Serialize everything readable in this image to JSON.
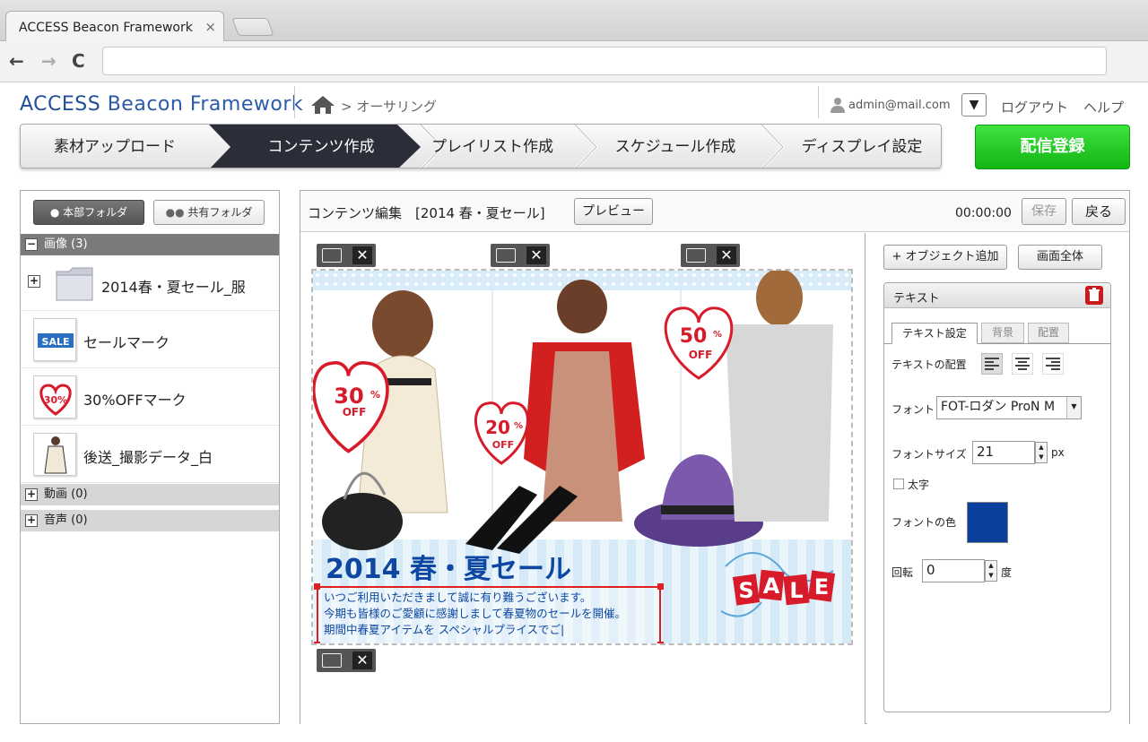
{
  "browser": {
    "tab_title": "ACCESS Beacon Framework",
    "tab_close": "×",
    "back": "←",
    "forward": "→",
    "reload": "C",
    "url": ""
  },
  "header": {
    "logo_access": "ACCESS",
    "logo_rest": " Beacon Framework",
    "breadcrumb": "> オーサリング",
    "user_email": "admin@mail.com",
    "dropdown_arrow": "▼",
    "logout": "ログアウト",
    "help": "ヘルプ"
  },
  "steps": [
    {
      "label": "素材アップロード",
      "active": false
    },
    {
      "label": "コンテンツ作成",
      "active": true
    },
    {
      "label": "プレイリスト作成",
      "active": false
    },
    {
      "label": "スケジュール作成",
      "active": false
    },
    {
      "label": "ディスプレイ設定",
      "active": false
    }
  ],
  "deliver_button": "配信登録",
  "left_panel": {
    "tab_hq": "本部フォルダ",
    "tab_shared": "共有フォルダ",
    "sections": [
      {
        "label": "画像 (3)",
        "expanded": true
      },
      {
        "label": "動画 (0)",
        "expanded": false
      },
      {
        "label": "音声 (0)",
        "expanded": false
      }
    ],
    "folder": "2014春・夏セール_服",
    "items": [
      {
        "label": "セールマーク",
        "icon": "sale-mark-thumbnail"
      },
      {
        "label": "30%OFFマーク",
        "icon": "30off-heart-thumbnail"
      },
      {
        "label": "後送_撮影データ_白",
        "icon": "photo-thumbnail"
      }
    ]
  },
  "editor": {
    "title": "コンテンツ編集　[2014 春・夏セール]",
    "preview": "プレビュー",
    "timecode": "00:00:00",
    "save": "保存",
    "back": "戻る",
    "close_glyph": "✕"
  },
  "banner": {
    "headline": "2014 春・夏セール",
    "body_lines": [
      "いつご利用いただきまして誠に有り難うございます。",
      "今期も皆様のご愛顧に感謝しまして春夏物のセールを開催。",
      "期間中春夏アイテムを スペシャルプライスでご|"
    ],
    "badges": [
      {
        "pct": "30",
        "unit": "%",
        "off": "OFF"
      },
      {
        "pct": "20",
        "unit": "%",
        "off": "OFF"
      },
      {
        "pct": "50",
        "unit": "%",
        "off": "OFF"
      }
    ],
    "sale_letters": [
      "S",
      "A",
      "L",
      "E"
    ]
  },
  "props": {
    "add_object": "+ オブジェクト追加",
    "full_screen": "画面全体",
    "panel_title": "テキスト",
    "tabs": [
      "テキスト設定",
      "背景",
      "配置"
    ],
    "align_label": "テキストの配置",
    "font_label": "フォント",
    "font_value": "FOT-ロダン ProN M",
    "size_label": "フォントサイズ",
    "size_value": "21",
    "size_unit": "px",
    "bold_label": "太字",
    "color_label": "フォントの色",
    "font_color": "#0a3f9e",
    "rotate_label": "回転",
    "rotate_value": "0",
    "rotate_unit": "度"
  },
  "colors": {
    "active_step": "#2b2e38",
    "deliver": "#1fc81f",
    "brand": "#2a5aa8",
    "headline": "#0d47a1",
    "sale_red": "#d81b2a"
  }
}
